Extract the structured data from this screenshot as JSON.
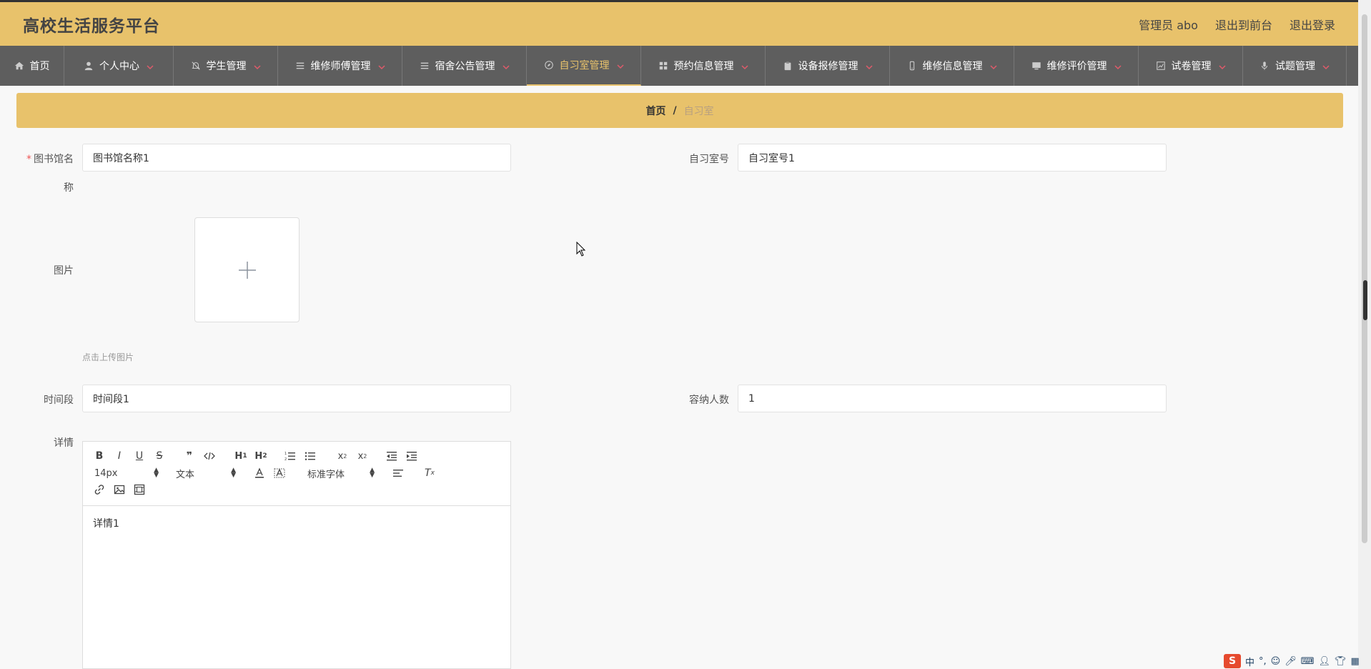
{
  "header": {
    "title": "高校生活服务平台",
    "user": "管理员 abo",
    "to_front": "退出到前台",
    "logout": "退出登录"
  },
  "nav": {
    "items": [
      {
        "label": "首页",
        "icon": "home-icon"
      },
      {
        "label": "个人中心",
        "icon": "user-icon"
      },
      {
        "label": "学生管理",
        "icon": "bell-off-icon"
      },
      {
        "label": "维修师傅管理",
        "icon": "list-icon"
      },
      {
        "label": "宿舍公告管理",
        "icon": "list-icon"
      },
      {
        "label": "自习室管理",
        "icon": "compass-icon"
      },
      {
        "label": "预约信息管理",
        "icon": "grid-icon"
      },
      {
        "label": "设备报修管理",
        "icon": "clipboard-icon"
      },
      {
        "label": "维修信息管理",
        "icon": "phone-icon"
      },
      {
        "label": "维修评价管理",
        "icon": "monitor-icon"
      },
      {
        "label": "试卷管理",
        "icon": "chart-icon"
      },
      {
        "label": "试题管理",
        "icon": "mic-icon"
      }
    ],
    "active_index": 5,
    "active_color": "#e8c26b"
  },
  "breadcrumb": {
    "home": "首页",
    "separator": "/",
    "current": "自习室"
  },
  "form": {
    "library_name_label_1": "图书馆名",
    "library_name_label_2": "称",
    "library_name_value": "图书馆名称1",
    "room_no_label": "自习室号",
    "room_no_value": "自习室号1",
    "picture_label": "图片",
    "upload_hint": "点击上传图片",
    "time_slot_label": "时间段",
    "time_slot_value": "时间段1",
    "capacity_label": "容纳人数",
    "capacity_value": "1",
    "detail_label": "详情",
    "detail_value": "详情1"
  },
  "editor": {
    "size_picker": "14px",
    "header_picker": "文本",
    "font_picker": "标准字体"
  },
  "tray": {
    "logo": "S",
    "ime": "中"
  },
  "colors": {
    "header_bg": "#e8c26b",
    "nav_bg": "#5e5e5e",
    "required": "#e55"
  }
}
